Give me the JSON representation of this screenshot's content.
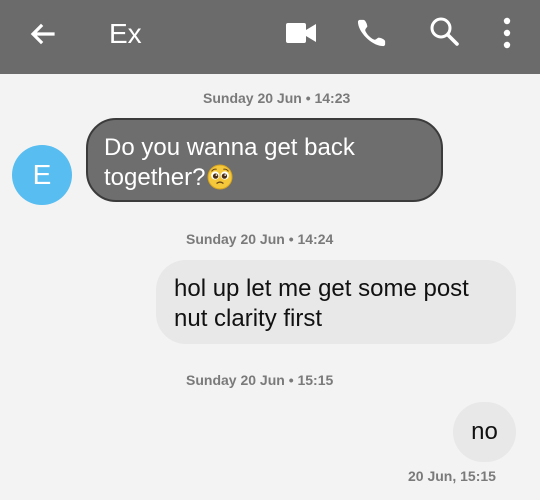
{
  "header": {
    "title": "Ex",
    "icons": {
      "back": "arrow-left-icon",
      "video": "video-call-icon",
      "call": "phone-icon",
      "search": "search-icon",
      "more": "more-vertical-icon"
    },
    "background_color": "#6b6b6b",
    "text_color": "#ffffff"
  },
  "conversation": {
    "contact_initial": "E",
    "avatar_color": "#58bdf0",
    "messages": [
      {
        "timestamp": "Sunday 20 Jun • 14:23",
        "direction": "incoming",
        "text": "Do you wanna get back together?",
        "emoji": "pleading-face-emoji"
      },
      {
        "timestamp": "Sunday 20 Jun • 14:24",
        "direction": "outgoing",
        "text": "hol up let me get some post nut clarity first"
      },
      {
        "timestamp": "Sunday 20 Jun • 15:15",
        "direction": "outgoing",
        "text": "no",
        "sent_time": "20 Jun, 15:15"
      }
    ]
  },
  "colors": {
    "background": "#f3f3f3",
    "incoming_bubble": "#6e6e6e",
    "outgoing_bubble": "#e8e8e8",
    "timestamp_text": "#7a7a7a"
  }
}
